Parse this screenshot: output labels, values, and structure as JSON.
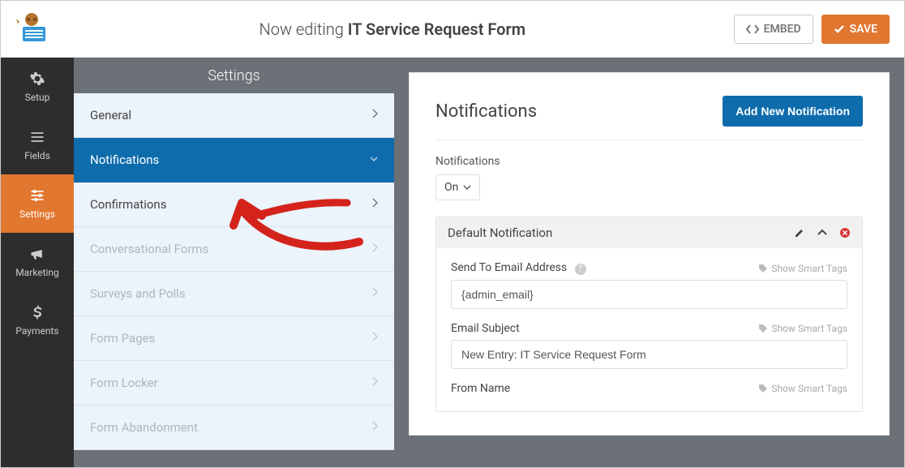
{
  "topbar": {
    "now_editing": "Now editing",
    "form_name": "IT Service Request Form",
    "embed": "EMBED",
    "save": "SAVE"
  },
  "leftbar": {
    "setup": "Setup",
    "fields": "Fields",
    "settings": "Settings",
    "marketing": "Marketing",
    "payments": "Payments"
  },
  "settings_header": "Settings",
  "settings_panels": [
    {
      "label": "General",
      "state": "normal"
    },
    {
      "label": "Notifications",
      "state": "active"
    },
    {
      "label": "Confirmations",
      "state": "normal"
    },
    {
      "label": "Conversational Forms",
      "state": "muted"
    },
    {
      "label": "Surveys and Polls",
      "state": "muted"
    },
    {
      "label": "Form Pages",
      "state": "muted"
    },
    {
      "label": "Form Locker",
      "state": "muted"
    },
    {
      "label": "Form Abandonment",
      "state": "muted"
    }
  ],
  "content": {
    "title": "Notifications",
    "add_btn": "Add New Notification",
    "toggle_label": "Notifications",
    "toggle_value": "On",
    "notif_title": "Default Notification",
    "smart_tags": "Show Smart Tags",
    "fields": {
      "send_to": {
        "label": "Send To Email Address",
        "value": "{admin_email}"
      },
      "subject": {
        "label": "Email Subject",
        "value": "New Entry: IT Service Request Form"
      },
      "from_name": {
        "label": "From Name",
        "value": ""
      }
    }
  }
}
